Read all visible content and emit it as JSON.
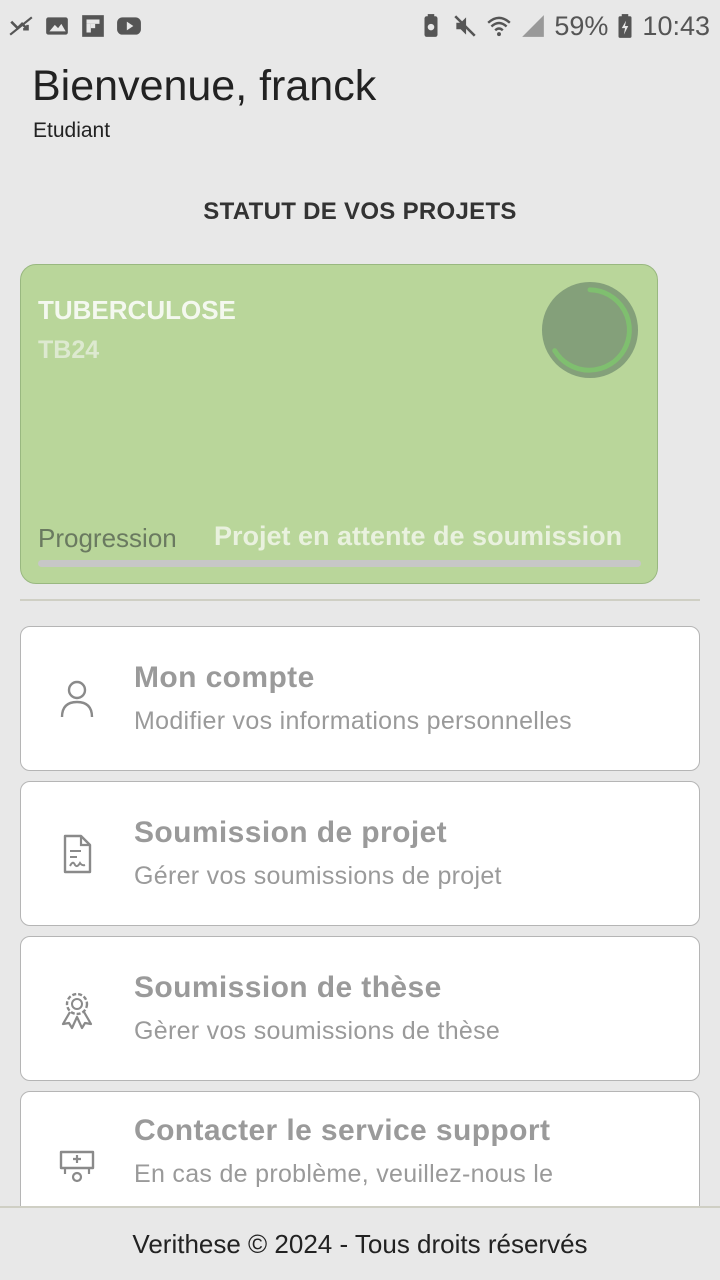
{
  "status_bar": {
    "battery_percent": "59%",
    "time": "10:43",
    "left_icons": [
      "missed-call-icon",
      "image-icon",
      "flipboard-icon",
      "youtube-icon"
    ],
    "right_icons": [
      "battery-saver-icon",
      "mute-icon",
      "wifi-icon",
      "signal-icon",
      "battery-icon"
    ]
  },
  "header": {
    "greeting": "Bienvenue, franck",
    "role": "Etudiant"
  },
  "projects": {
    "section_title": "STATUT DE VOS PROJETS",
    "card": {
      "name": "TUBERCULOSE",
      "code": "TB24",
      "progress_label": "Progression",
      "status": "Projet en attente de soumission",
      "progress_fraction": 0.0,
      "card_color": "#b9d69a"
    }
  },
  "menu": {
    "items": [
      {
        "title": "Mon compte",
        "subtitle": "Modifier vos informations personnelles",
        "icon": "user-icon"
      },
      {
        "title": "Soumission de projet",
        "subtitle": "Gérer vos soumissions de projet",
        "icon": "document-icon"
      },
      {
        "title": "Soumission de thèse",
        "subtitle": "Gèrer vos soumissions de thèse",
        "icon": "award-icon"
      },
      {
        "title": "Contacter le service support",
        "subtitle": "En cas de problème, veuillez-nous le",
        "icon": "support-icon"
      }
    ]
  },
  "footer": {
    "text": "Verithese © 2024 - Tous droits réservés"
  }
}
